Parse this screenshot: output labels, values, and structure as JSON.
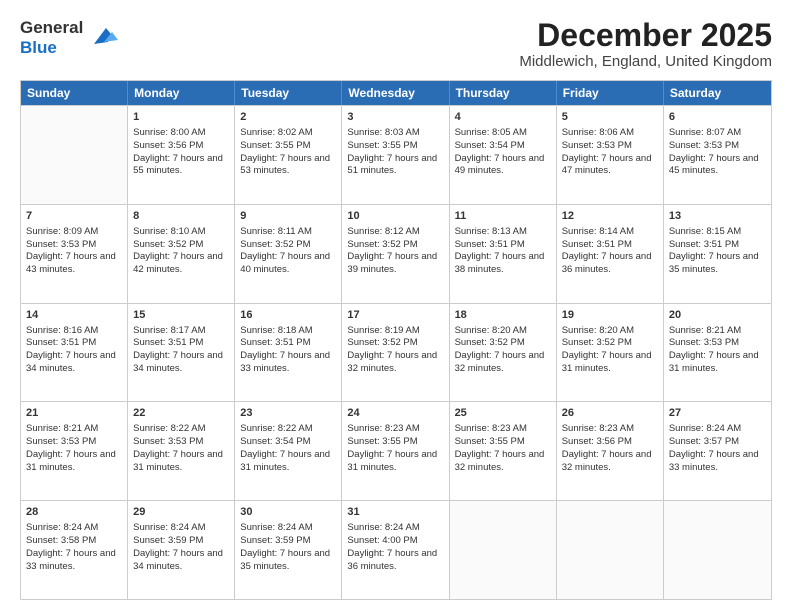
{
  "header": {
    "logo": {
      "line1": "General",
      "line2": "Blue"
    },
    "title": "December 2025",
    "location": "Middlewich, England, United Kingdom"
  },
  "weekdays": [
    "Sunday",
    "Monday",
    "Tuesday",
    "Wednesday",
    "Thursday",
    "Friday",
    "Saturday"
  ],
  "weeks": [
    [
      {
        "day": "",
        "empty": true
      },
      {
        "day": "1",
        "sunrise": "Sunrise: 8:00 AM",
        "sunset": "Sunset: 3:56 PM",
        "daylight": "Daylight: 7 hours and 55 minutes."
      },
      {
        "day": "2",
        "sunrise": "Sunrise: 8:02 AM",
        "sunset": "Sunset: 3:55 PM",
        "daylight": "Daylight: 7 hours and 53 minutes."
      },
      {
        "day": "3",
        "sunrise": "Sunrise: 8:03 AM",
        "sunset": "Sunset: 3:55 PM",
        "daylight": "Daylight: 7 hours and 51 minutes."
      },
      {
        "day": "4",
        "sunrise": "Sunrise: 8:05 AM",
        "sunset": "Sunset: 3:54 PM",
        "daylight": "Daylight: 7 hours and 49 minutes."
      },
      {
        "day": "5",
        "sunrise": "Sunrise: 8:06 AM",
        "sunset": "Sunset: 3:53 PM",
        "daylight": "Daylight: 7 hours and 47 minutes."
      },
      {
        "day": "6",
        "sunrise": "Sunrise: 8:07 AM",
        "sunset": "Sunset: 3:53 PM",
        "daylight": "Daylight: 7 hours and 45 minutes."
      }
    ],
    [
      {
        "day": "7",
        "sunrise": "Sunrise: 8:09 AM",
        "sunset": "Sunset: 3:53 PM",
        "daylight": "Daylight: 7 hours and 43 minutes."
      },
      {
        "day": "8",
        "sunrise": "Sunrise: 8:10 AM",
        "sunset": "Sunset: 3:52 PM",
        "daylight": "Daylight: 7 hours and 42 minutes."
      },
      {
        "day": "9",
        "sunrise": "Sunrise: 8:11 AM",
        "sunset": "Sunset: 3:52 PM",
        "daylight": "Daylight: 7 hours and 40 minutes."
      },
      {
        "day": "10",
        "sunrise": "Sunrise: 8:12 AM",
        "sunset": "Sunset: 3:52 PM",
        "daylight": "Daylight: 7 hours and 39 minutes."
      },
      {
        "day": "11",
        "sunrise": "Sunrise: 8:13 AM",
        "sunset": "Sunset: 3:51 PM",
        "daylight": "Daylight: 7 hours and 38 minutes."
      },
      {
        "day": "12",
        "sunrise": "Sunrise: 8:14 AM",
        "sunset": "Sunset: 3:51 PM",
        "daylight": "Daylight: 7 hours and 36 minutes."
      },
      {
        "day": "13",
        "sunrise": "Sunrise: 8:15 AM",
        "sunset": "Sunset: 3:51 PM",
        "daylight": "Daylight: 7 hours and 35 minutes."
      }
    ],
    [
      {
        "day": "14",
        "sunrise": "Sunrise: 8:16 AM",
        "sunset": "Sunset: 3:51 PM",
        "daylight": "Daylight: 7 hours and 34 minutes."
      },
      {
        "day": "15",
        "sunrise": "Sunrise: 8:17 AM",
        "sunset": "Sunset: 3:51 PM",
        "daylight": "Daylight: 7 hours and 34 minutes."
      },
      {
        "day": "16",
        "sunrise": "Sunrise: 8:18 AM",
        "sunset": "Sunset: 3:51 PM",
        "daylight": "Daylight: 7 hours and 33 minutes."
      },
      {
        "day": "17",
        "sunrise": "Sunrise: 8:19 AM",
        "sunset": "Sunset: 3:52 PM",
        "daylight": "Daylight: 7 hours and 32 minutes."
      },
      {
        "day": "18",
        "sunrise": "Sunrise: 8:20 AM",
        "sunset": "Sunset: 3:52 PM",
        "daylight": "Daylight: 7 hours and 32 minutes."
      },
      {
        "day": "19",
        "sunrise": "Sunrise: 8:20 AM",
        "sunset": "Sunset: 3:52 PM",
        "daylight": "Daylight: 7 hours and 31 minutes."
      },
      {
        "day": "20",
        "sunrise": "Sunrise: 8:21 AM",
        "sunset": "Sunset: 3:53 PM",
        "daylight": "Daylight: 7 hours and 31 minutes."
      }
    ],
    [
      {
        "day": "21",
        "sunrise": "Sunrise: 8:21 AM",
        "sunset": "Sunset: 3:53 PM",
        "daylight": "Daylight: 7 hours and 31 minutes."
      },
      {
        "day": "22",
        "sunrise": "Sunrise: 8:22 AM",
        "sunset": "Sunset: 3:53 PM",
        "daylight": "Daylight: 7 hours and 31 minutes."
      },
      {
        "day": "23",
        "sunrise": "Sunrise: 8:22 AM",
        "sunset": "Sunset: 3:54 PM",
        "daylight": "Daylight: 7 hours and 31 minutes."
      },
      {
        "day": "24",
        "sunrise": "Sunrise: 8:23 AM",
        "sunset": "Sunset: 3:55 PM",
        "daylight": "Daylight: 7 hours and 31 minutes."
      },
      {
        "day": "25",
        "sunrise": "Sunrise: 8:23 AM",
        "sunset": "Sunset: 3:55 PM",
        "daylight": "Daylight: 7 hours and 32 minutes."
      },
      {
        "day": "26",
        "sunrise": "Sunrise: 8:23 AM",
        "sunset": "Sunset: 3:56 PM",
        "daylight": "Daylight: 7 hours and 32 minutes."
      },
      {
        "day": "27",
        "sunrise": "Sunrise: 8:24 AM",
        "sunset": "Sunset: 3:57 PM",
        "daylight": "Daylight: 7 hours and 33 minutes."
      }
    ],
    [
      {
        "day": "28",
        "sunrise": "Sunrise: 8:24 AM",
        "sunset": "Sunset: 3:58 PM",
        "daylight": "Daylight: 7 hours and 33 minutes."
      },
      {
        "day": "29",
        "sunrise": "Sunrise: 8:24 AM",
        "sunset": "Sunset: 3:59 PM",
        "daylight": "Daylight: 7 hours and 34 minutes."
      },
      {
        "day": "30",
        "sunrise": "Sunrise: 8:24 AM",
        "sunset": "Sunset: 3:59 PM",
        "daylight": "Daylight: 7 hours and 35 minutes."
      },
      {
        "day": "31",
        "sunrise": "Sunrise: 8:24 AM",
        "sunset": "Sunset: 4:00 PM",
        "daylight": "Daylight: 7 hours and 36 minutes."
      },
      {
        "day": "",
        "empty": true
      },
      {
        "day": "",
        "empty": true
      },
      {
        "day": "",
        "empty": true
      }
    ]
  ]
}
